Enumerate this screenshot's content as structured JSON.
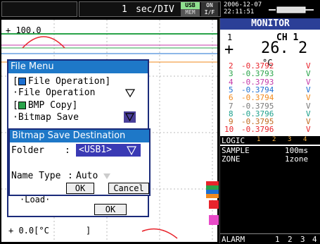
{
  "status": {
    "timebase_number": "1",
    "timebase_unit": "sec/DIV",
    "usb_label": "USB",
    "mem_label": "MEM",
    "on_label": "ON",
    "if_label": "I/F",
    "date": "2006-12-07",
    "time": "22:11:51"
  },
  "graph": {
    "scale_top": "+ 100.0",
    "scale_bottom": "+  0.0[°C",
    "bottom_marker": "]"
  },
  "monitor": {
    "title": "MONITOR",
    "ch1_index": "1",
    "ch1_label": "CH 1",
    "ch1_sign": "+",
    "ch1_value": "26. 2",
    "ch1_unit": "°C",
    "channels": [
      {
        "num": "2",
        "value": "-0.3792",
        "unit": "V",
        "color": "#e8242c"
      },
      {
        "num": "3",
        "value": "-0.3793",
        "unit": "V",
        "color": "#2aa34a"
      },
      {
        "num": "4",
        "value": "-0.3793",
        "unit": "V",
        "color": "#c43aa8"
      },
      {
        "num": "5",
        "value": "-0.3794",
        "unit": "V",
        "color": "#1b6fd1"
      },
      {
        "num": "6",
        "value": "-0.3794",
        "unit": "V",
        "color": "#f08a1e"
      },
      {
        "num": "7",
        "value": "-0.3795",
        "unit": "V",
        "color": "#7a7a7a"
      },
      {
        "num": "8",
        "value": "-0.3796",
        "unit": "V",
        "color": "#1ea08c"
      },
      {
        "num": "9",
        "value": "-0.3795",
        "unit": "V",
        "color": "#c06a20"
      },
      {
        "num": "10",
        "value": "-0.3796",
        "unit": "V",
        "color": "#e8242c"
      }
    ],
    "logic_label": "LOGIC",
    "logic_items": [
      "1",
      "2",
      "3",
      "4"
    ],
    "sample_label": "SAMPLE",
    "sample_value": "100ms",
    "zone_label": "ZONE",
    "zone_value": "1zone",
    "alarm_label": "ALARM",
    "alarm_items": [
      "1",
      "2",
      "3",
      "4"
    ]
  },
  "file_menu": {
    "title": "File Menu",
    "file_op_header": "[",
    "file_op_group": "File Operation]",
    "file_op_item": "·File Operation",
    "bmp_group_open": "[",
    "bmp_group": "BMP Copy]",
    "bitmap_save_item": "·Bitmap Save",
    "load_item": "·Load·",
    "ok_label": "OK"
  },
  "bitmap_dialog": {
    "title": "Bitmap Save Destination",
    "folder_label": "Folder",
    "folder_colon": ":",
    "folder_value": "<USB1>",
    "name_type_label": "Name Type",
    "name_type_colon": ":",
    "name_type_value": "Auto",
    "ok_label": "OK",
    "cancel_label": "Cancel"
  },
  "colors": {
    "title_bar": "#1e78c8",
    "monitor_header": "#2b3f97",
    "dropdown": "#4a3f9a",
    "folder_highlight": "#3a3ab4"
  }
}
